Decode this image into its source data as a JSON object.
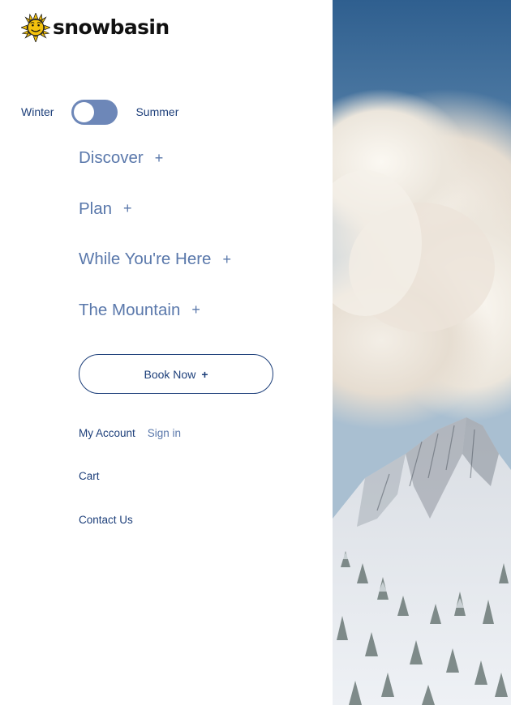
{
  "brand": {
    "logo_text": "snowbasin",
    "logo_icon": "sun-face-logo-icon"
  },
  "season_toggle": {
    "left_label": "Winter",
    "right_label": "Summer",
    "state": "Winter"
  },
  "nav": {
    "items": [
      {
        "label": "Discover",
        "icon": "+"
      },
      {
        "label": "Plan",
        "icon": "+"
      },
      {
        "label": "While You're Here",
        "icon": "+"
      },
      {
        "label": "The Mountain",
        "icon": "+"
      }
    ]
  },
  "book_now": {
    "label": "Book Now",
    "icon": "+"
  },
  "account": {
    "my_account_label": "My Account",
    "sign_in_label": "Sign in",
    "cart_label": "Cart",
    "contact_label": "Contact Us"
  },
  "colors": {
    "primary_navy": "#1d3f7a",
    "nav_blue": "#5a78ab",
    "toggle_blue": "#6d87b8",
    "logo_yellow": "#f4c20d"
  },
  "hero": {
    "description_icon": "mountain-photo-image"
  }
}
